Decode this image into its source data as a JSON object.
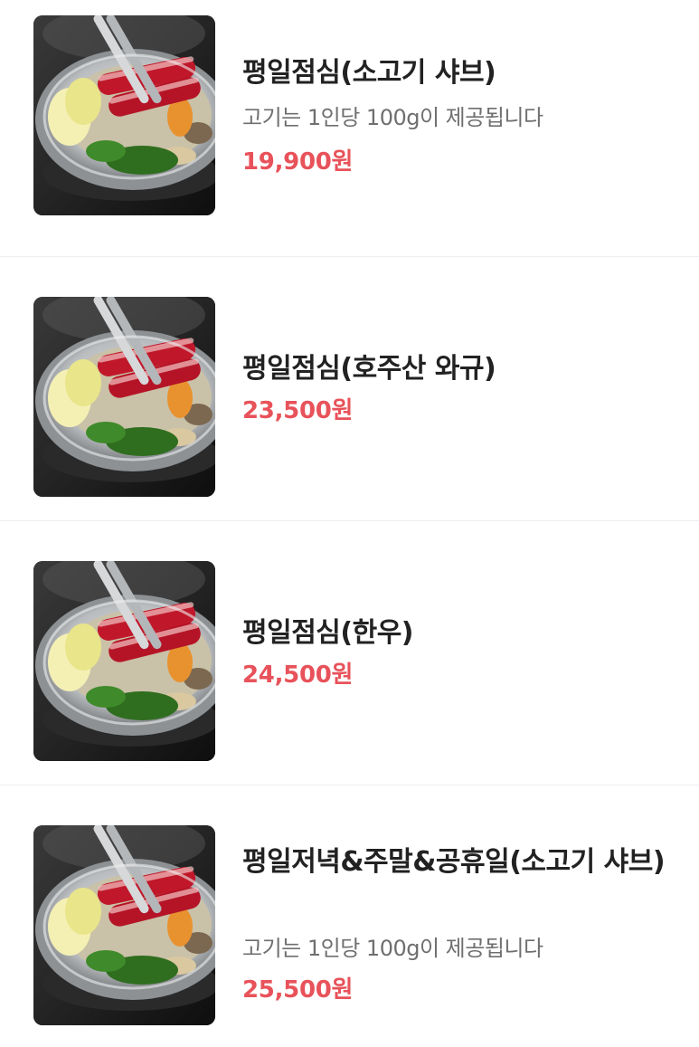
{
  "menu": {
    "items": [
      {
        "name": "평일점심(소고기 샤브)",
        "description": "고기는 1인당 100g이 제공됩니다",
        "price": "19,900원",
        "image_icon": "shabu-hotpot-photo"
      },
      {
        "name": "평일점심(호주산 와규)",
        "description": "",
        "price": "23,500원",
        "image_icon": "shabu-hotpot-photo"
      },
      {
        "name": "평일점심(한우)",
        "description": "",
        "price": "24,500원",
        "image_icon": "shabu-hotpot-photo"
      },
      {
        "name": "평일저녁&주말&공휴일(소고기 샤브)",
        "description": "고기는 1인당 100g이 제공됩니다",
        "price": "25,500원",
        "image_icon": "shabu-hotpot-photo"
      }
    ]
  },
  "colors": {
    "price": "#e8525a",
    "title": "#222222",
    "description": "#6f6f6f",
    "divider": "#eceef2"
  }
}
